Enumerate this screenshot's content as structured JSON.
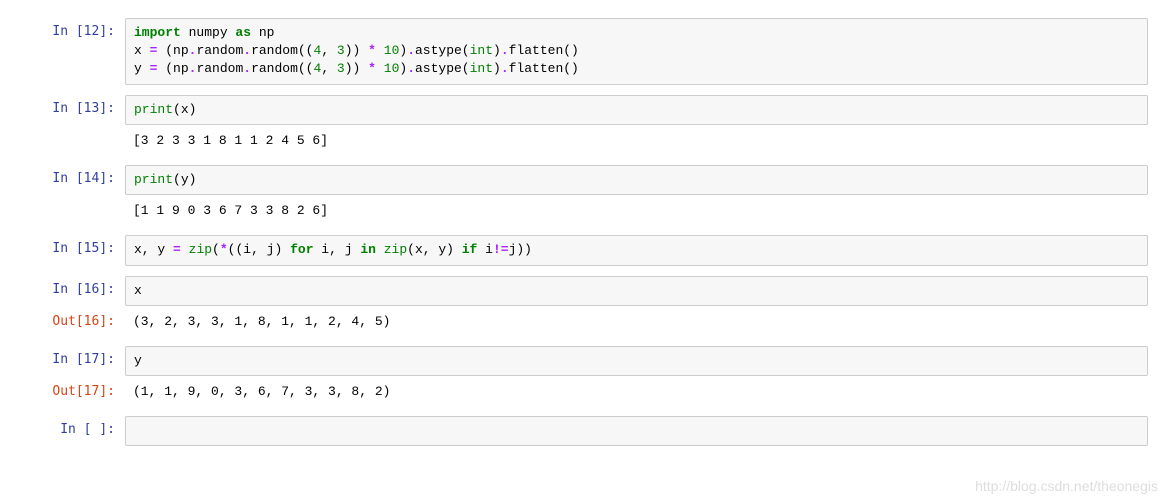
{
  "cells": [
    {
      "prompt_in": "In [12]:",
      "code_html": "<span class='kw-green'>import</span> numpy <span class='kw-green'>as</span> np\nx <span class='op'>=</span> (np<span class='op'>.</span>random<span class='op'>.</span>random((<span class='num'>4</span>, <span class='num'>3</span>)) <span class='op'>*</span> <span class='num'>10</span>)<span class='op'>.</span>astype(<span class='builtin'>int</span>)<span class='op'>.</span>flatten()\ny <span class='op'>=</span> (np<span class='op'>.</span>random<span class='op'>.</span>random((<span class='num'>4</span>, <span class='num'>3</span>)) <span class='op'>*</span> <span class='num'>10</span>)<span class='op'>.</span>astype(<span class='builtin'>int</span>)<span class='op'>.</span>flatten()"
    },
    {
      "prompt_in": "In [13]:",
      "code_html": "<span class='builtin'>print</span>(x)",
      "output": "[3 2 3 3 1 8 1 1 2 4 5 6]"
    },
    {
      "prompt_in": "In [14]:",
      "code_html": "<span class='builtin'>print</span>(y)",
      "output": "[1 1 9 0 3 6 7 3 3 8 2 6]"
    },
    {
      "prompt_in": "In [15]:",
      "code_html": "x, y <span class='op'>=</span> <span class='builtin'>zip</span>(<span class='op'>*</span>((i, j) <span class='kw-green'>for</span> i, j <span class='kw-green'>in</span> <span class='builtin'>zip</span>(x, y) <span class='kw-green'>if</span> i<span class='op'>!=</span>j))"
    },
    {
      "prompt_in": "In [16]:",
      "code_html": "x",
      "prompt_out": "Out[16]:",
      "result": "(3, 2, 3, 3, 1, 8, 1, 1, 2, 4, 5)"
    },
    {
      "prompt_in": "In [17]:",
      "code_html": "y",
      "prompt_out": "Out[17]:",
      "result": "(1, 1, 9, 0, 3, 6, 7, 3, 3, 8, 2)"
    },
    {
      "prompt_in": "In [ ]:",
      "code_html": "",
      "selected": true
    }
  ],
  "watermark": "http://blog.csdn.net/theonegis"
}
